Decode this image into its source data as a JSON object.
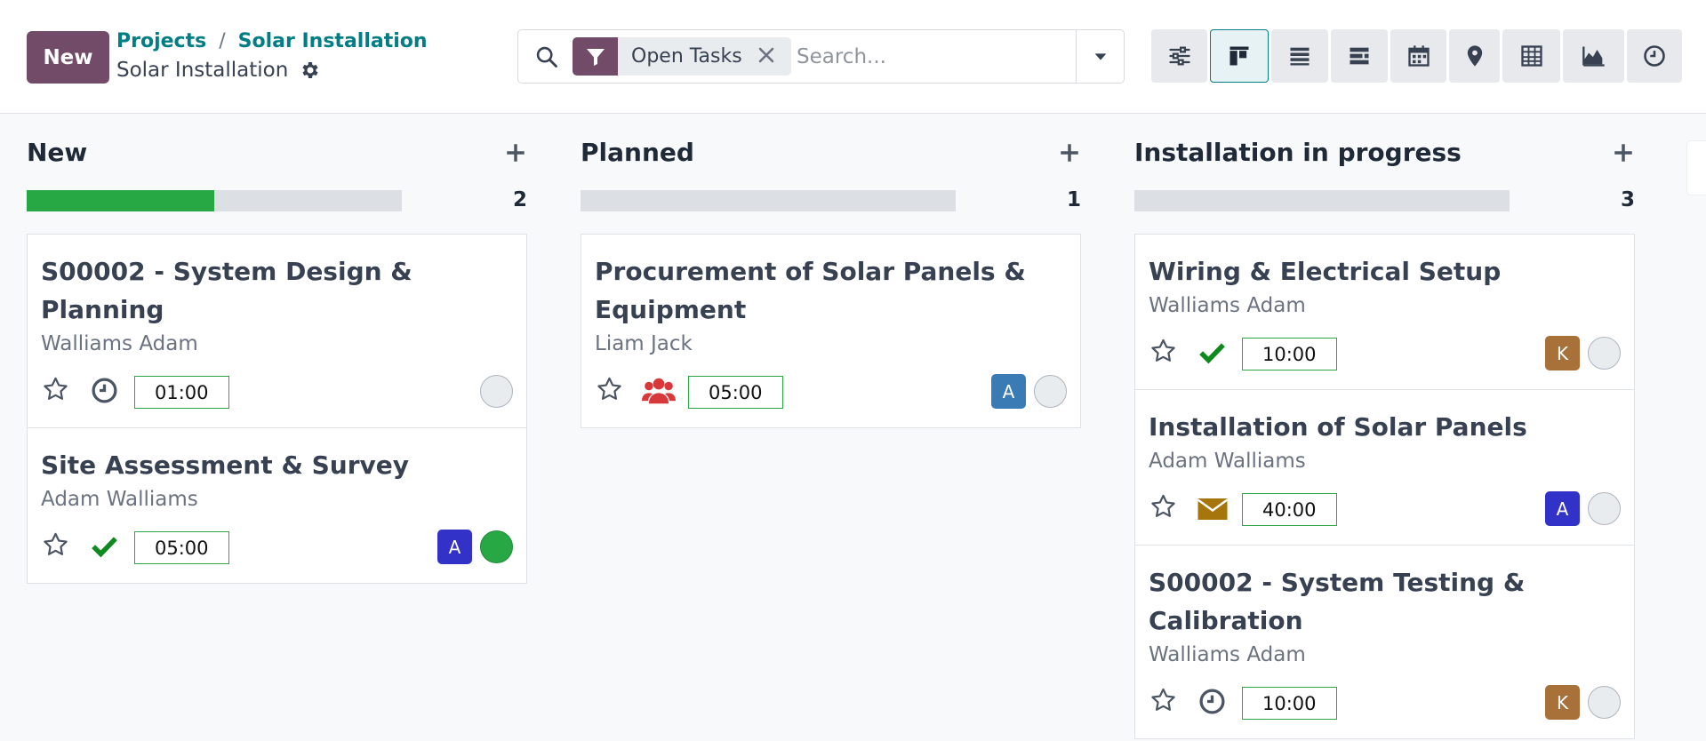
{
  "control_panel": {
    "new_button": "New",
    "breadcrumb": [
      "Projects",
      "Solar Installation"
    ],
    "breadcrumb_sep": "/",
    "page_title": "Solar Installation"
  },
  "search": {
    "facet_label": "Open Tasks",
    "placeholder": "Search..."
  },
  "views": [
    "settings",
    "kanban",
    "list",
    "gantt",
    "calendar",
    "map",
    "pivot",
    "graph",
    "activity"
  ],
  "columns": [
    {
      "title": "New",
      "count": "2",
      "progress_fraction": 0.5,
      "cards": [
        {
          "title": "S00002 - System Design & Planning",
          "assignee": "Walliams Adam",
          "activity": "clock-icon",
          "hours": "01:00",
          "avatar": "",
          "state": "normal"
        },
        {
          "title": "Site Assessment & Survey",
          "assignee": "Adam Walliams",
          "activity": "check-icon",
          "hours": "05:00",
          "avatar": "A",
          "state": "done"
        }
      ]
    },
    {
      "title": "Planned",
      "count": "1",
      "progress_fraction": 0,
      "cards": [
        {
          "title": "Procurement of Solar Panels & Equipment",
          "assignee": "Liam Jack",
          "activity": "users-icon",
          "hours": "05:00",
          "avatar": "A",
          "state": "normal"
        }
      ]
    },
    {
      "title": "Installation in progress",
      "count": "3",
      "progress_fraction": 0,
      "cards": [
        {
          "title": "Wiring & Electrical Setup",
          "assignee": "Walliams Adam",
          "activity": "check-icon",
          "hours": "10:00",
          "avatar": "K",
          "state": "normal"
        },
        {
          "title": "Installation of Solar Panels",
          "assignee": "Adam Walliams",
          "activity": "envelope-icon",
          "hours": "40:00",
          "avatar": "A",
          "state": "normal"
        },
        {
          "title": "S00002 - System Testing & Calibration",
          "assignee": "Walliams Adam",
          "activity": "clock-icon",
          "hours": "10:00",
          "avatar": "K",
          "state": "normal"
        }
      ]
    }
  ],
  "colors": {
    "brand": "#714b67",
    "link": "#017e84",
    "progress": "#28a745",
    "avatar_a": "#3232c8",
    "avatar_a_alt": "#3b7bb5",
    "avatar_k": "#a8713a",
    "activity_done": "#0f8a1f",
    "activity_users": "#d9383a",
    "activity_mail": "#a6750b"
  }
}
